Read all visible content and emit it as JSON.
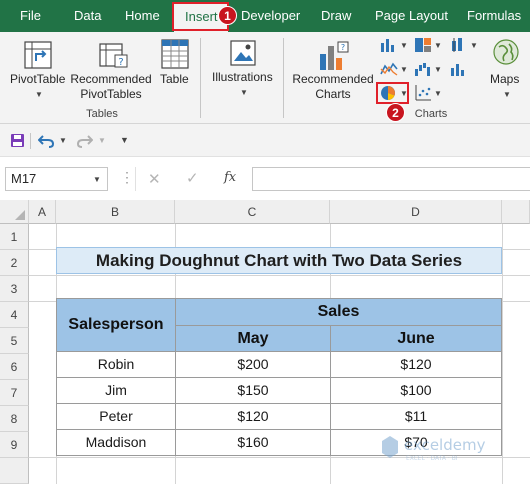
{
  "tabs": [
    "File",
    "Data",
    "Home",
    "Insert",
    "Developer",
    "Draw",
    "Page Layout",
    "Formulas"
  ],
  "active_tab": "Insert",
  "callouts": [
    "1",
    "2"
  ],
  "ribbon": {
    "pivottable": "PivotTable",
    "recommended_pivot_l1": "Recommended",
    "recommended_pivot_l2": "PivotTables",
    "table": "Table",
    "tables_group": "Tables",
    "illustrations": "Illustrations",
    "recommended_charts_l1": "Recommended",
    "recommended_charts_l2": "Charts",
    "charts_group": "Charts",
    "maps": "Maps"
  },
  "formula_bar": {
    "name_box": "M17",
    "fx": "fx",
    "value": ""
  },
  "columns": [
    "A",
    "B",
    "C",
    "D"
  ],
  "rows": [
    "1",
    "2",
    "3",
    "4",
    "5",
    "6",
    "7",
    "8",
    "9"
  ],
  "sheet": {
    "title": "Making Doughnut Chart with Two Data Series",
    "header_salesperson": "Salesperson",
    "header_sales": "Sales",
    "header_may": "May",
    "header_june": "June",
    "data": [
      {
        "name": "Robin",
        "may": "$200",
        "june": "$120"
      },
      {
        "name": "Jim",
        "may": "$150",
        "june": "$100"
      },
      {
        "name": "Peter",
        "may": "$120",
        "june": "$11"
      },
      {
        "name": "Maddison",
        "may": "$160",
        "june": "$70"
      }
    ]
  },
  "watermark": {
    "name": "exceldemy",
    "tagline": "EXCEL · DATA · BI"
  },
  "colors": {
    "excel_green": "#217346",
    "header_blue": "#9dc3e6",
    "title_fill": "#ddebf7",
    "callout_red": "#c8151f"
  }
}
